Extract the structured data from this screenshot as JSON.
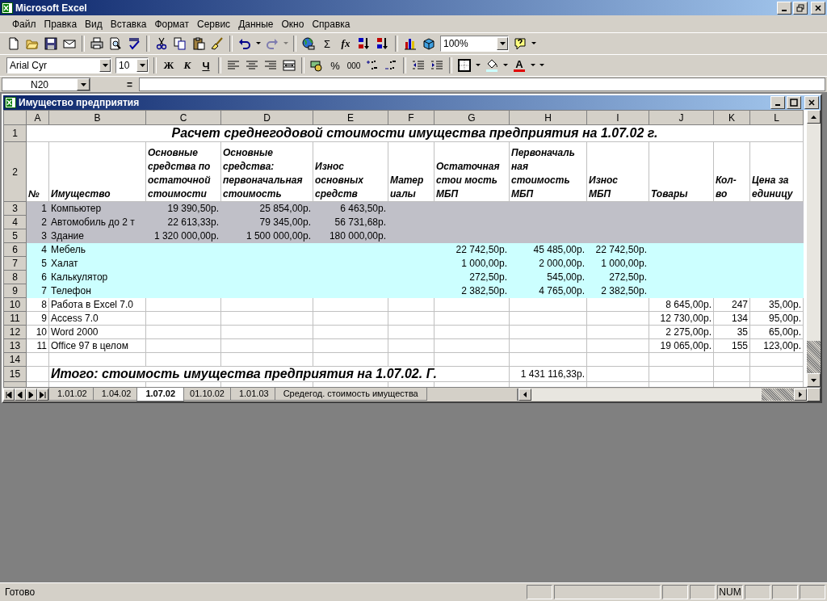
{
  "app": {
    "title": "Microsoft Excel"
  },
  "menu": [
    "Файл",
    "Правка",
    "Вид",
    "Вставка",
    "Формат",
    "Сервис",
    "Данные",
    "Окно",
    "Справка"
  ],
  "standard_toolbar": [
    {
      "kind": "new",
      "disabled": false
    },
    {
      "kind": "open",
      "disabled": false
    },
    {
      "kind": "save",
      "disabled": false
    },
    {
      "kind": "mail",
      "disabled": false
    },
    {
      "kind": "sep"
    },
    {
      "kind": "print",
      "disabled": false
    },
    {
      "kind": "preview",
      "disabled": false
    },
    {
      "kind": "spell",
      "disabled": false
    },
    {
      "kind": "sep"
    },
    {
      "kind": "cut",
      "disabled": false
    },
    {
      "kind": "copy",
      "disabled": false
    },
    {
      "kind": "paste",
      "disabled": false
    },
    {
      "kind": "brush",
      "disabled": false
    },
    {
      "kind": "sep"
    },
    {
      "kind": "undo",
      "disabled": false
    },
    {
      "kind": "caret",
      "disabled": false
    },
    {
      "kind": "redo",
      "disabled": true
    },
    {
      "kind": "caret",
      "disabled": true
    },
    {
      "kind": "sep"
    },
    {
      "kind": "web",
      "disabled": false
    },
    {
      "kind": "text",
      "text": "Σ",
      "disabled": false
    },
    {
      "kind": "fx",
      "text": "fx",
      "disabled": false
    },
    {
      "kind": "sortaz",
      "disabled": false
    },
    {
      "kind": "sortza",
      "disabled": false
    },
    {
      "kind": "sep"
    },
    {
      "kind": "chart",
      "disabled": false
    },
    {
      "kind": "map",
      "disabled": false
    },
    {
      "kind": "zoom",
      "value": "100%"
    },
    {
      "kind": "help",
      "disabled": false
    },
    {
      "kind": "caret",
      "disabled": false
    }
  ],
  "formatting_toolbar": [
    {
      "kind": "font",
      "value": "Arial Cyr"
    },
    {
      "kind": "fontsize",
      "value": "10"
    },
    {
      "kind": "sep"
    },
    {
      "kind": "bold",
      "text": "Ж",
      "disabled": false
    },
    {
      "kind": "italic",
      "text": "К",
      "disabled": false
    },
    {
      "kind": "underline",
      "text": "Ч",
      "disabled": false
    },
    {
      "kind": "sep"
    },
    {
      "kind": "alignleft",
      "disabled": false
    },
    {
      "kind": "aligncenter",
      "disabled": false
    },
    {
      "kind": "alignright",
      "disabled": false
    },
    {
      "kind": "merge",
      "disabled": false
    },
    {
      "kind": "sep"
    },
    {
      "kind": "currency",
      "disabled": false
    },
    {
      "kind": "text",
      "text": "%",
      "disabled": false
    },
    {
      "kind": "small",
      "text": "000",
      "disabled": false
    },
    {
      "kind": "incdec",
      "disabled": false
    },
    {
      "kind": "decdec",
      "disabled": false
    },
    {
      "kind": "sep"
    },
    {
      "kind": "outdent",
      "disabled": false
    },
    {
      "kind": "indent",
      "disabled": false
    },
    {
      "kind": "sep"
    },
    {
      "kind": "borders",
      "disabled": false
    },
    {
      "kind": "caret",
      "disabled": false
    },
    {
      "kind": "fill",
      "disabled": false
    },
    {
      "kind": "caret",
      "disabled": false
    },
    {
      "kind": "fontcolor",
      "text": "A",
      "disabled": false
    },
    {
      "kind": "caret",
      "disabled": false
    },
    {
      "kind": "caret",
      "disabled": false
    }
  ],
  "formula_bar": {
    "name_box": "N20",
    "equals": "="
  },
  "workbook": {
    "title": "Имущество предприятия",
    "columns": [
      "A",
      "B",
      "C",
      "D",
      "E",
      "F",
      "G",
      "H",
      "I",
      "J",
      "K",
      "L"
    ],
    "rows": [
      {
        "n": "1",
        "kind": "title",
        "text": "Расчет среднегодовой стоимости имущества предприятия на 1.07.02 г."
      },
      {
        "n": "2",
        "kind": "header",
        "cells": {
          "A": "№",
          "B": "Имущество",
          "C": "Основные\nсредства по\nостаточной\nстоимости",
          "D": "Основные\nсредства:\nпервоначальная\nстоимость",
          "E": "Износ\nосновных\nсредств",
          "F": "Матер\nиалы",
          "G": "Остаточная\nстои мость\nМБП",
          "H": "Первоначаль\nная\nстоимость\nМБП",
          "I": "Износ\nМБП",
          "J": "Товары",
          "K": "Кол-\nво",
          "L": "Цена за\nединицу"
        }
      },
      {
        "n": "3",
        "kind": "data",
        "color": "#c0c0c8",
        "cells": {
          "A": "1",
          "B": "Компьютер",
          "C": "19 390,50р.",
          "D": "25 854,00р.",
          "E": "6 463,50р."
        }
      },
      {
        "n": "4",
        "kind": "data",
        "color": "#c0c0c8",
        "cells": {
          "A": "2",
          "B": "Автомобиль до 2 т",
          "C": "22 613,33р.",
          "D": "79 345,00р.",
          "E": "56 731,68р."
        }
      },
      {
        "n": "5",
        "kind": "data",
        "color": "#c0c0c8",
        "cells": {
          "A": "3",
          "B": "Здание",
          "C": "1 320 000,00р.",
          "D": "1 500 000,00р.",
          "E": "180 000,00р."
        }
      },
      {
        "n": "6",
        "kind": "data",
        "color": "#ccffff",
        "cells": {
          "A": "4",
          "B": "Мебель",
          "G": "22 742,50р.",
          "H": "45 485,00р.",
          "I": "22 742,50р."
        }
      },
      {
        "n": "7",
        "kind": "data",
        "color": "#ccffff",
        "cells": {
          "A": "5",
          "B": "Халат",
          "G": "1 000,00р.",
          "H": "2 000,00р.",
          "I": "1 000,00р."
        }
      },
      {
        "n": "8",
        "kind": "data",
        "color": "#ccffff",
        "cells": {
          "A": "6",
          "B": "Калькулятор",
          "G": "272,50р.",
          "H": "545,00р.",
          "I": "272,50р."
        }
      },
      {
        "n": "9",
        "kind": "data",
        "color": "#ccffff",
        "cells": {
          "A": "7",
          "B": "Телефон",
          "G": "2 382,50р.",
          "H": "4 765,00р.",
          "I": "2 382,50р."
        }
      },
      {
        "n": "10",
        "kind": "data",
        "color": "#ffffff",
        "cells": {
          "A": "8",
          "B": "Работа в Excel 7.0",
          "J": "8 645,00р.",
          "K": "247",
          "L": "35,00р."
        }
      },
      {
        "n": "11",
        "kind": "data",
        "color": "#ffffff",
        "cells": {
          "A": "9",
          "B": "Access 7.0",
          "J": "12 730,00р.",
          "K": "134",
          "L": "95,00р."
        }
      },
      {
        "n": "12",
        "kind": "data",
        "color": "#ffffff",
        "cells": {
          "A": "10",
          "B": "Word 2000",
          "J": "2 275,00р.",
          "K": "35",
          "L": "65,00р."
        }
      },
      {
        "n": "13",
        "kind": "data",
        "color": "#ffffff",
        "cells": {
          "A": "11",
          "B": "Office 97 в целом",
          "J": "19 065,00р.",
          "K": "155",
          "L": "123,00р."
        }
      },
      {
        "n": "14",
        "kind": "data",
        "color": "#ffffff"
      },
      {
        "n": "15",
        "kind": "total",
        "cells": {
          "B": "Итого: стоимость имущества предприятия на 1.07.02. Г.",
          "H": "1 431 116,33р."
        }
      }
    ],
    "sheet_tabs": [
      {
        "label": "1.01.02",
        "selected": false
      },
      {
        "label": "1.04.02",
        "selected": false
      },
      {
        "label": "1.07.02",
        "selected": true
      },
      {
        "label": "01.10.02",
        "selected": false
      },
      {
        "label": "1.01.03",
        "selected": false
      },
      {
        "label": "Средегод. стоимость имущества",
        "selected": false
      }
    ]
  },
  "status_bar": {
    "text": "Готово",
    "indicators": [
      "NUM"
    ]
  }
}
